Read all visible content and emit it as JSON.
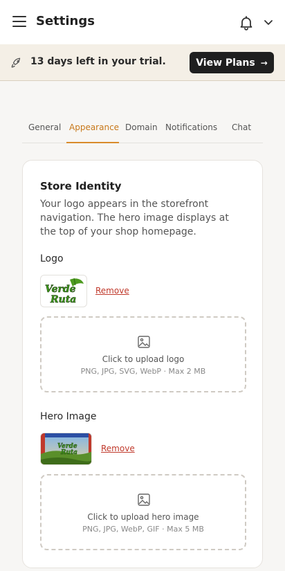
{
  "header": {
    "title": "Settings",
    "icons": {
      "menu": "menu-icon",
      "bell": "bell-icon",
      "chevron": "chevron-down-icon"
    }
  },
  "trial": {
    "text": "13 days left in your trial.",
    "button_label": "View Plans",
    "button_arrow": "→"
  },
  "tabs": [
    {
      "label": "General",
      "active": false
    },
    {
      "label": "Appearance",
      "active": true
    },
    {
      "label": "Domain",
      "active": false
    },
    {
      "label": "Notifications",
      "active": false
    },
    {
      "label": "Chat",
      "active": false
    }
  ],
  "store_identity": {
    "title": "Store Identity",
    "description": "Your logo appears in the storefront navigation. The hero image displays at the top of your shop homepage.",
    "logo": {
      "label": "Logo",
      "remove_label": "Remove",
      "upload_text": "Click to upload logo",
      "upload_hint": "PNG, JPG, SVG, WebP · Max 2 MB",
      "thumb_text_line1": "Verde",
      "thumb_text_line2": "Ruta"
    },
    "hero": {
      "label": "Hero Image",
      "remove_label": "Remove",
      "upload_text": "Click to upload hero image",
      "upload_hint": "PNG, JPG, WebP, GIF · Max 5 MB",
      "thumb_text_line1": "Verde",
      "thumb_text_line2": "Ruta"
    }
  },
  "colors": {
    "accent": "#d98b2b",
    "banner_bg": "#f4efe6",
    "remove_link": "#c0392b",
    "button_dark": "#1f1f1f"
  }
}
